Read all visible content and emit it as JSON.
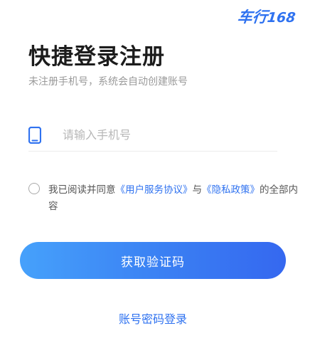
{
  "brand": {
    "logo_text": "车行",
    "logo_number": "168"
  },
  "header": {
    "title": "快捷登录注册",
    "subtitle": "未注册手机号，系统会自动创建账号"
  },
  "phone": {
    "placeholder": "请输入手机号",
    "value": ""
  },
  "agreement": {
    "checked": false,
    "prefix": "我已阅读并同意",
    "user_agreement": "《用户服务协议》",
    "joiner": "与",
    "privacy_policy": "《隐私政策》",
    "suffix": "的全部内容"
  },
  "actions": {
    "get_code_label": "获取验证码",
    "password_login_label": "账号密码登录"
  },
  "colors": {
    "accent": "#2f72f0",
    "button_gradient_start": "#46a1fb",
    "button_gradient_end": "#3568f0"
  }
}
